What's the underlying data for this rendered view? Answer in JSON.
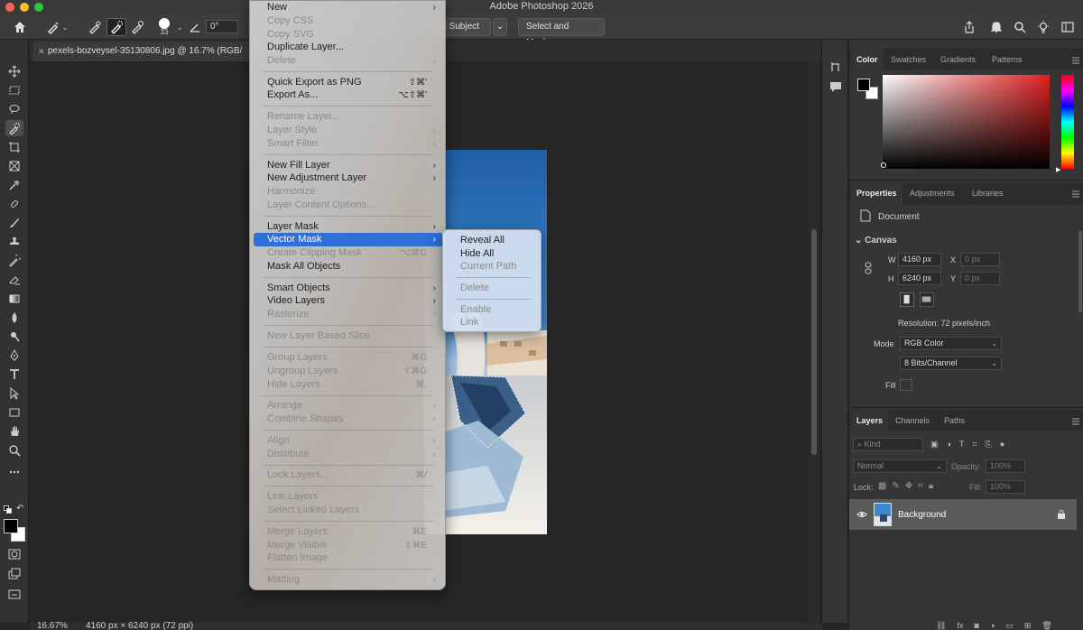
{
  "app": {
    "title": "Adobe Photoshop 2026"
  },
  "options_bar": {
    "brush_size": "33",
    "angle": "0°",
    "select_subject_label": "ct Subject",
    "select_and_mask_label": "Select and Mask..."
  },
  "document": {
    "tab_title": "pexels-bozveysel-35130806.jpg @ 16.7% (RGB/",
    "zoom": "16.67%",
    "size_info": "4160 px × 6240 px (72 ppi)"
  },
  "main_menu": {
    "items": [
      {
        "label": "New",
        "disabled": false,
        "submenu": true
      },
      {
        "label": "Copy CSS",
        "disabled": true
      },
      {
        "label": "Copy SVG",
        "disabled": true
      },
      {
        "label": "Duplicate Layer...",
        "disabled": false
      },
      {
        "label": "Delete",
        "disabled": true,
        "submenu": true
      },
      {
        "label": "Quick Export as PNG",
        "disabled": false,
        "shortcut": "⇧⌘'"
      },
      {
        "label": "Export As...",
        "disabled": false,
        "shortcut": "⌥⇧⌘'"
      },
      {
        "label": "Rename Layer...",
        "disabled": true
      },
      {
        "label": "Layer Style",
        "disabled": true,
        "submenu": true
      },
      {
        "label": "Smart Filter",
        "disabled": true,
        "submenu": true
      },
      {
        "label": "New Fill Layer",
        "disabled": false,
        "submenu": true
      },
      {
        "label": "New Adjustment Layer",
        "disabled": false,
        "submenu": true
      },
      {
        "label": "Harmonize",
        "disabled": true
      },
      {
        "label": "Layer Content Options...",
        "disabled": true
      },
      {
        "label": "Layer Mask",
        "disabled": false,
        "submenu": true
      },
      {
        "label": "Vector Mask",
        "disabled": false,
        "submenu": true,
        "highlighted": true
      },
      {
        "label": "Create Clipping Mask",
        "disabled": true,
        "shortcut": "⌥⌘G"
      },
      {
        "label": "Mask All Objects",
        "disabled": false
      },
      {
        "label": "Smart Objects",
        "disabled": false,
        "submenu": true
      },
      {
        "label": "Video Layers",
        "disabled": false,
        "submenu": true
      },
      {
        "label": "Rasterize",
        "disabled": true,
        "submenu": true
      },
      {
        "label": "New Layer Based Slice",
        "disabled": true
      },
      {
        "label": "Group Layers",
        "disabled": true,
        "shortcut": "⌘G"
      },
      {
        "label": "Ungroup Layers",
        "disabled": true,
        "shortcut": "⇧⌘G"
      },
      {
        "label": "Hide Layers",
        "disabled": true,
        "shortcut": "⌘,"
      },
      {
        "label": "Arrange",
        "disabled": true,
        "submenu": true
      },
      {
        "label": "Combine Shapes",
        "disabled": true,
        "submenu": true
      },
      {
        "label": "Align",
        "disabled": true,
        "submenu": true
      },
      {
        "label": "Distribute",
        "disabled": true,
        "submenu": true
      },
      {
        "label": "Lock Layers...",
        "disabled": true,
        "shortcut": "⌘/"
      },
      {
        "label": "Link Layers",
        "disabled": true
      },
      {
        "label": "Select Linked Layers",
        "disabled": true
      },
      {
        "label": "Merge Layers",
        "disabled": true,
        "shortcut": "⌘E"
      },
      {
        "label": "Merge Visible",
        "disabled": true,
        "shortcut": "⇧⌘E"
      },
      {
        "label": "Flatten Image",
        "disabled": true
      },
      {
        "label": "Matting",
        "disabled": true,
        "submenu": true
      }
    ]
  },
  "submenu": {
    "items": [
      {
        "label": "Reveal All",
        "disabled": false
      },
      {
        "label": "Hide All",
        "disabled": false
      },
      {
        "label": "Current Path",
        "disabled": true
      },
      {
        "label": "Delete",
        "disabled": true
      },
      {
        "label": "Enable",
        "disabled": true
      },
      {
        "label": "Link",
        "disabled": true
      }
    ]
  },
  "color_panel": {
    "tabs": [
      "Color",
      "Swatches",
      "Gradients",
      "Patterns"
    ],
    "active_tab": "Color"
  },
  "properties_panel": {
    "tabs": [
      "Properties",
      "Adjustments",
      "Libraries"
    ],
    "document_label": "Document",
    "canvas_section": "Canvas",
    "w_label": "W",
    "w_value": "4160 px",
    "h_label": "H",
    "h_value": "6240 px",
    "x_label": "X",
    "x_value": "0 px",
    "y_label": "Y",
    "y_value": "0 px",
    "resolution": "Resolution: 72 pixels/inch",
    "mode_label": "Mode",
    "mode_value": "RGB Color",
    "depth_value": "8 Bits/Channel",
    "fill_label": "Fill"
  },
  "layers_panel": {
    "tabs": [
      "Layers",
      "Channels",
      "Paths"
    ],
    "filter_placeholder": "Kind",
    "blend_mode": "Normal",
    "opacity_label": "Opacity:",
    "opacity_value": "100%",
    "lock_label": "Lock:",
    "fill_label": "Fill:",
    "fill_value": "100%",
    "layers": [
      {
        "name": "Background",
        "visible": true,
        "locked": true
      }
    ]
  },
  "colors": {
    "accent": "#2f6fd6",
    "foreground": "#000000",
    "background": "#ffffff"
  }
}
